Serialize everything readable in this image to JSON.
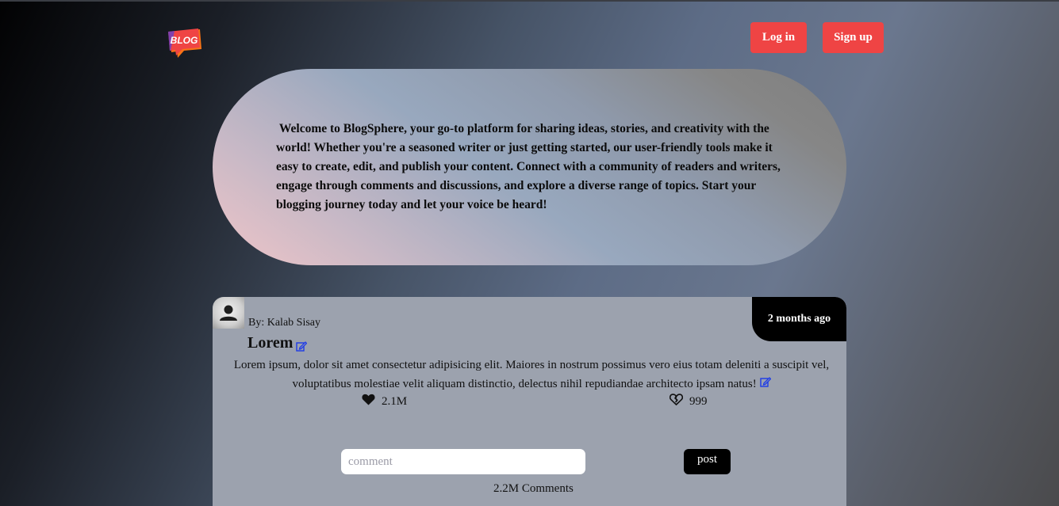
{
  "header": {
    "logo_text": "BLOG",
    "login_label": "Log in",
    "signup_label": "Sign up"
  },
  "hero": {
    "text": " Welcome to BlogSphere, your go-to platform for sharing ideas, stories, and creativity with the world! Whether you're a seasoned writer or just getting started, our user-friendly tools make it easy to create, edit, and publish your content. Connect with a community of readers and writers, engage through comments and discussions, and explore a diverse range of topics. Start your blogging journey today and let your voice be heard!"
  },
  "post": {
    "author": "By: Kalab Sisay",
    "time": "2 months ago",
    "title": "Lorem",
    "body": "Lorem ipsum, dolor sit amet consectetur adipisicing elit. Maiores in nostrum possimus vero eius totam deleniti a suscipit vel, voluptatibus molestiae velit aliquam distinctio, delectus nihil repudiandae architecto ipsam natus!",
    "likes": "2.1M",
    "dislikes": "999",
    "comment_placeholder": "comment",
    "post_label": "post",
    "comments": "2.2M Comments"
  },
  "colors": {
    "accent": "#ef4444",
    "edit_icon": "#1d3ae8",
    "card_bg": "#9ca2ae"
  }
}
